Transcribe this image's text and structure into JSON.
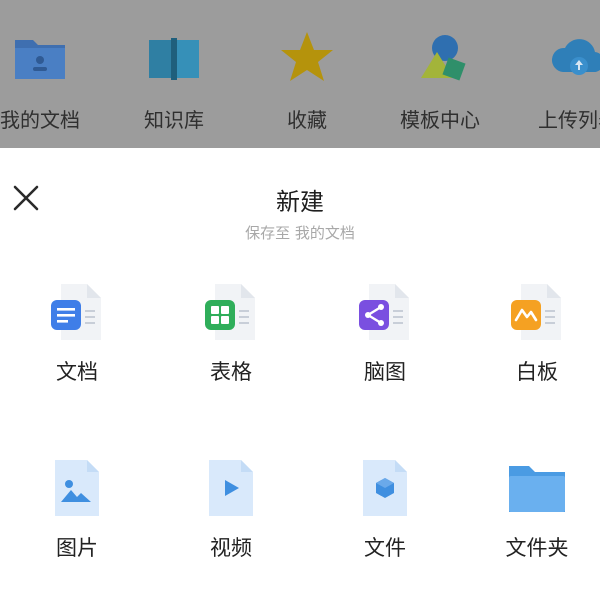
{
  "background_nav": {
    "items": [
      {
        "label": "我的文档",
        "icon": "folder-user-icon"
      },
      {
        "label": "知识库",
        "icon": "book-icon"
      },
      {
        "label": "收藏",
        "icon": "star-icon"
      },
      {
        "label": "模板中心",
        "icon": "shapes-icon"
      },
      {
        "label": "上传列表",
        "icon": "cloud-upload-icon"
      }
    ]
  },
  "sheet": {
    "title": "新建",
    "subtitle": "保存至 我的文档",
    "close_icon": "close-icon"
  },
  "create_options": [
    {
      "label": "文档",
      "icon": "doc-file-icon",
      "color": "#3f7ee8"
    },
    {
      "label": "表格",
      "icon": "sheet-file-icon",
      "color": "#2fae5a"
    },
    {
      "label": "脑图",
      "icon": "mindmap-file-icon",
      "color": "#7a4fe0"
    },
    {
      "label": "白板",
      "icon": "whiteboard-file-icon",
      "color": "#f5a122"
    },
    {
      "label": "图片",
      "icon": "image-icon",
      "color": "#3f8fe0"
    },
    {
      "label": "视频",
      "icon": "video-icon",
      "color": "#3f8fe0"
    },
    {
      "label": "文件",
      "icon": "file-icon",
      "color": "#3f8fe0"
    },
    {
      "label": "文件夹",
      "icon": "folder-icon",
      "color": "#4a9be3"
    }
  ]
}
